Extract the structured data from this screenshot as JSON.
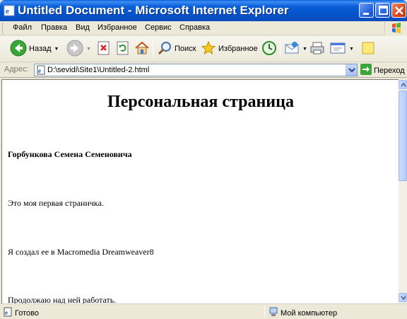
{
  "window": {
    "title": "Untitled Document - Microsoft Internet Explorer"
  },
  "menu": {
    "items": [
      "Файл",
      "Правка",
      "Вид",
      "Избранное",
      "Сервис",
      "Справка"
    ]
  },
  "toolbar": {
    "back_label": "Назад",
    "search_label": "Поиск",
    "favorites_label": "Избранное"
  },
  "address": {
    "label": "Адрес:",
    "value": "D:\\sevidi\\Site1\\Untitled-2.html",
    "go_label": "Переход"
  },
  "page": {
    "heading": "Персональная страница",
    "name_line": "Горбункова Семена Семеновича",
    "paragraphs": [
      "Это моя первая страничка.",
      "Я создал ее в Macromedia Dreamweaver8",
      "Продолжаю над ней работать."
    ]
  },
  "status": {
    "left_text": "Готово",
    "zone_text": "Мой компьютер"
  },
  "colors": {
    "titlebar_blue": "#0a5fd8",
    "window_chrome": "#ece9d8",
    "content_bg": "#ffffff"
  },
  "icons": {
    "back": "back-arrow-icon",
    "forward": "forward-arrow-icon",
    "stop": "stop-icon",
    "refresh": "refresh-icon",
    "home": "home-icon",
    "search": "search-icon",
    "favorites": "star-icon",
    "history": "history-icon",
    "mail": "mail-icon",
    "print": "print-icon",
    "edit": "edit-icon",
    "messenger": "note-icon",
    "go": "go-arrow-icon"
  }
}
